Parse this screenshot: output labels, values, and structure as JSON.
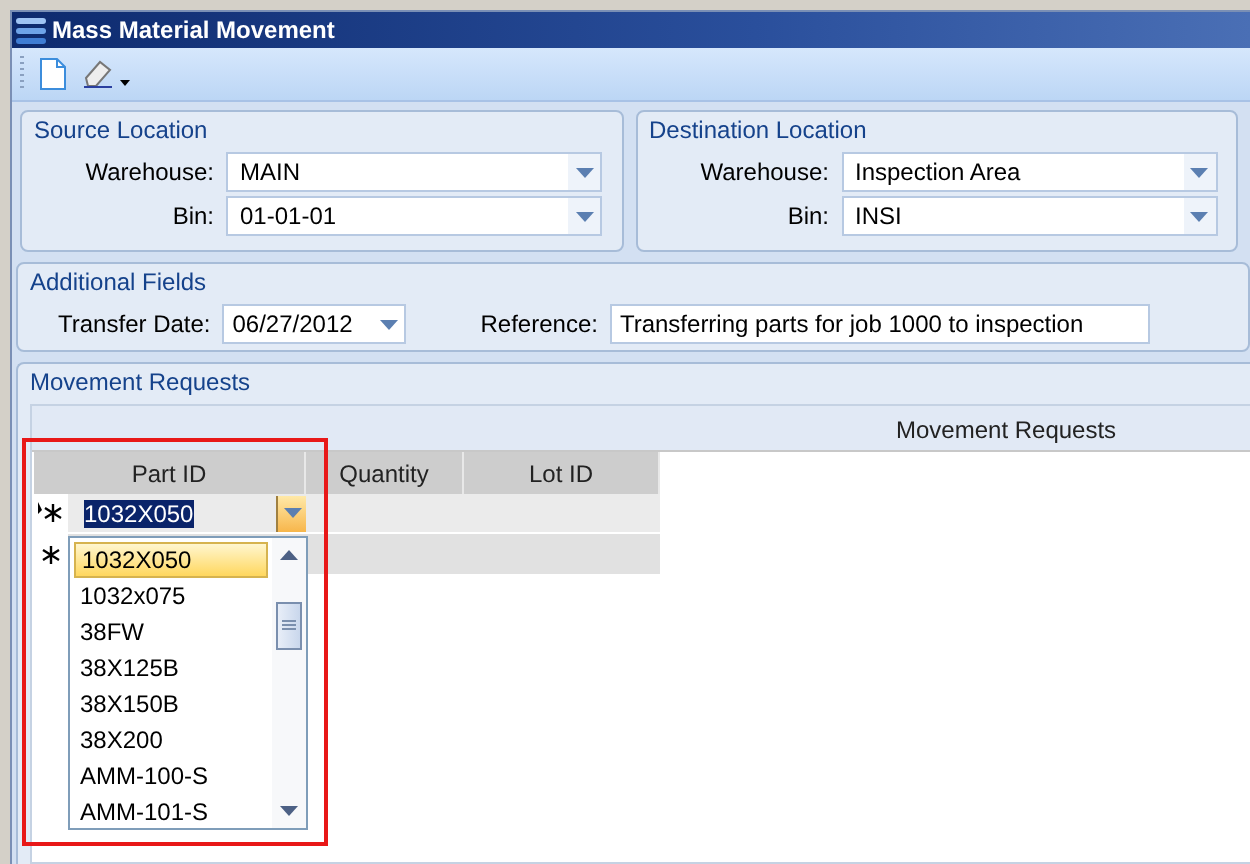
{
  "window": {
    "title": "Mass Material Movement"
  },
  "source_location": {
    "title": "Source Location",
    "fields": [
      {
        "label": "Warehouse:",
        "value": "MAIN"
      },
      {
        "label": "Bin:",
        "value": "01-01-01"
      }
    ]
  },
  "destination_location": {
    "title": "Destination Location",
    "fields": [
      {
        "label": "Warehouse:",
        "value": "Inspection Area"
      },
      {
        "label": "Bin:",
        "value": "INSI"
      }
    ]
  },
  "additional_fields": {
    "title": "Additional Fields",
    "transfer_date": {
      "label": "Transfer Date:",
      "value": "06/27/2012"
    },
    "reference": {
      "label": "Reference:",
      "value": "Transferring parts for job 1000 to inspection"
    }
  },
  "movement_requests": {
    "title": "Movement Requests",
    "band_caption": "Movement Requests",
    "grid": {
      "columns": [
        "Part ID",
        "Quantity",
        "Lot ID"
      ],
      "rows": [
        {
          "kind": "editing",
          "part_id": "1032X050"
        },
        {
          "kind": "new"
        }
      ]
    },
    "dropdown": {
      "items": [
        {
          "label": "1032X050",
          "selected": true
        },
        {
          "label": "1032x075",
          "selected": false
        },
        {
          "label": "38FW",
          "selected": false
        },
        {
          "label": "38X125B",
          "selected": false
        },
        {
          "label": "38X150B",
          "selected": false
        },
        {
          "label": "38X200",
          "selected": false
        },
        {
          "label": "AMM-100-S",
          "selected": false
        },
        {
          "label": "AMM-101-S",
          "selected": false
        }
      ]
    }
  }
}
